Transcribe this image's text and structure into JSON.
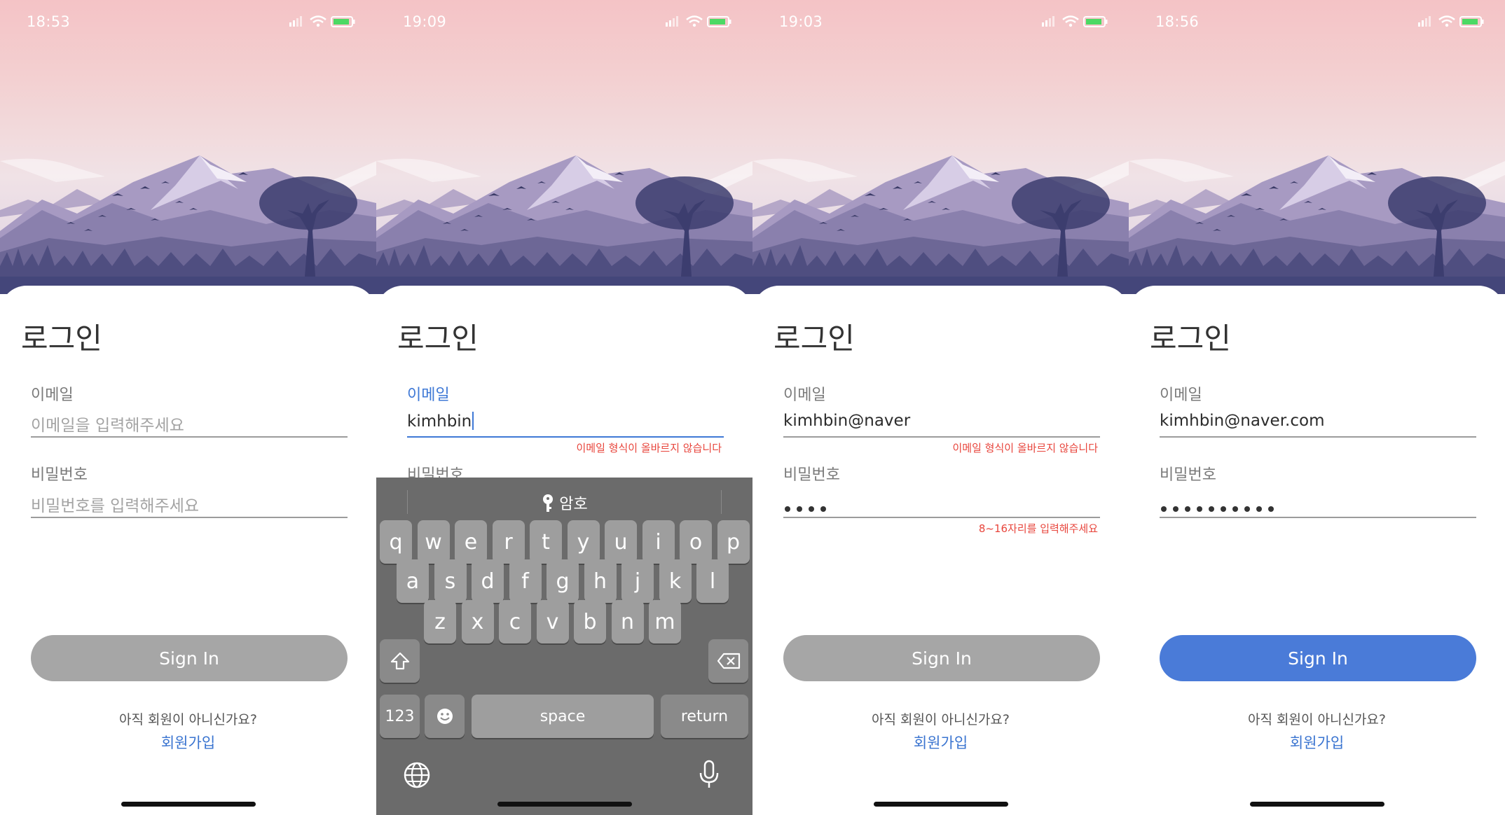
{
  "screens": [
    {
      "time": "18:53",
      "title": "로그인",
      "email": {
        "label": "이메일",
        "placeholder": "이메일을 입력해주세요"
      },
      "password": {
        "label": "비밀번호",
        "placeholder": "비밀번호를 입력해주세요"
      },
      "signin_label": "Sign In",
      "signup_question": "아직 회원이 아니신가요?",
      "signup_link": "회원가입"
    },
    {
      "time": "19:09",
      "title": "로그인",
      "email": {
        "label": "이메일",
        "value": "kimhbin",
        "error": "이메일 형식이 올바르지 않습니다"
      },
      "password": {
        "label": "비밀번호"
      },
      "keyboard": {
        "suggestion": "암호",
        "row1": [
          "q",
          "w",
          "e",
          "r",
          "t",
          "y",
          "u",
          "i",
          "o",
          "p"
        ],
        "row2": [
          "a",
          "s",
          "d",
          "f",
          "g",
          "h",
          "j",
          "k",
          "l"
        ],
        "row3": [
          "z",
          "x",
          "c",
          "v",
          "b",
          "n",
          "m"
        ],
        "numbers_key": "123",
        "space_key": "space",
        "return_key": "return"
      }
    },
    {
      "time": "19:03",
      "title": "로그인",
      "email": {
        "label": "이메일",
        "value": "kimhbin@naver",
        "error": "이메일 형식이 올바르지 않습니다"
      },
      "password": {
        "label": "비밀번호",
        "masked_length": 4,
        "error": "8~16자리를 입력해주세요"
      },
      "signin_label": "Sign In",
      "signup_question": "아직 회원이 아니신가요?",
      "signup_link": "회원가입"
    },
    {
      "time": "18:56",
      "title": "로그인",
      "email": {
        "label": "이메일",
        "value": "kimhbin@naver.com"
      },
      "password": {
        "label": "비밀번호",
        "masked_length": 10
      },
      "signin_label": "Sign In",
      "signin_enabled": true,
      "signup_question": "아직 회원이 아니신가요?",
      "signup_link": "회원가입"
    }
  ],
  "colors": {
    "accent": "#4a7bd8",
    "error": "#e8453c",
    "disabled_button": "#a6a6a6",
    "link": "#3a74d0"
  }
}
